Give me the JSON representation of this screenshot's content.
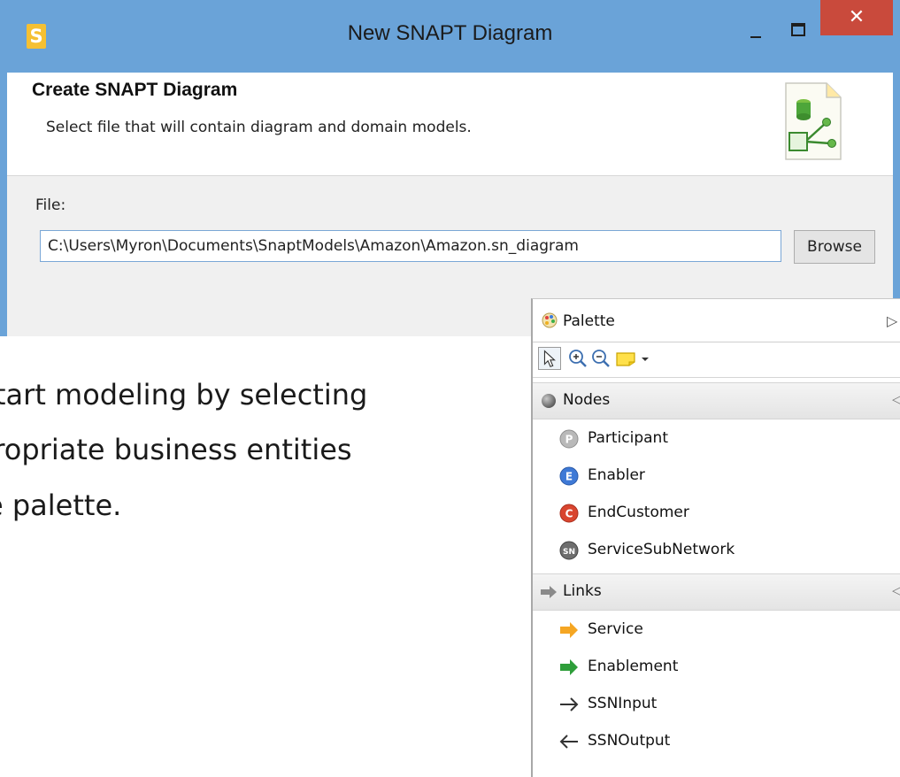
{
  "window": {
    "title": "New SNAPT Diagram",
    "app_icon_letter": "S",
    "close_glyph": "✕"
  },
  "wizard": {
    "header_title": "Create SNAPT Diagram",
    "header_description": "Select file that will contain diagram and domain models.",
    "file_label": "File:",
    "file_value": "C:\\Users\\Myron\\Documents\\SnaptModels\\Amazon\\Amazon.sn_diagram",
    "browse_label": "Browse"
  },
  "caption": {
    "line1": "tart modeling by selecting",
    "line2": "propriate business entities",
    "line3": "e palette."
  },
  "palette": {
    "title": "Palette",
    "toggle_glyph": "▷",
    "nodes": {
      "label": "Nodes",
      "chevron": "◁",
      "items": [
        {
          "label": "Participant",
          "badge": "P",
          "color": "#b9b9b9"
        },
        {
          "label": "Enabler",
          "badge": "E",
          "color": "#3e79d6"
        },
        {
          "label": "EndCustomer",
          "badge": "C",
          "color": "#d9452f"
        },
        {
          "label": "ServiceSubNetwork",
          "badge": "SN",
          "color": "#6e6e6e"
        }
      ]
    },
    "links": {
      "label": "Links",
      "chevron": "◁",
      "items": [
        {
          "label": "Service",
          "icon": "orange-arrow-icon",
          "color": "#f5a623"
        },
        {
          "label": "Enablement",
          "icon": "green-arrow-icon",
          "color": "#2e9e3a"
        },
        {
          "label": "SSNInput",
          "icon": "right-arrow-icon",
          "color": "#333333"
        },
        {
          "label": "SSNOutput",
          "icon": "left-arrow-icon",
          "color": "#333333"
        }
      ]
    }
  },
  "colors": {
    "titlebar": "#6aa3d8",
    "close_button": "#c94a3c"
  }
}
